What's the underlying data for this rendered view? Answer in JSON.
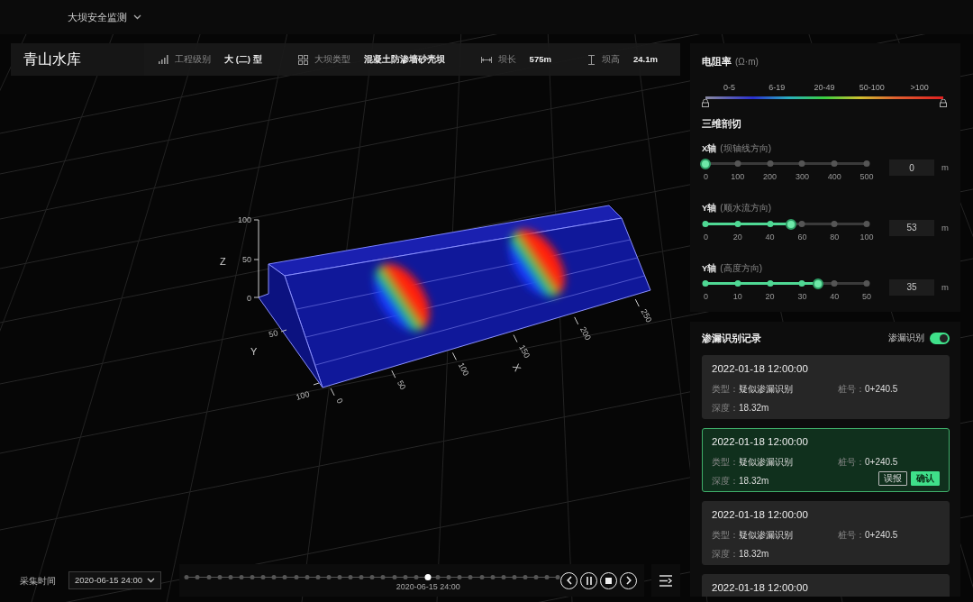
{
  "header": {
    "title": "大坝安全监测"
  },
  "info": {
    "name": "青山水库",
    "stats": [
      {
        "kind": "level",
        "label": "工程级别",
        "value": "大 (二) 型"
      },
      {
        "kind": "type",
        "label": "大坝类型",
        "value": "混凝土防渗墙砂壳坝"
      },
      {
        "kind": "length",
        "label": "坝长",
        "value": "575m"
      },
      {
        "kind": "height",
        "label": "坝高",
        "value": "24.1m"
      }
    ]
  },
  "model": {
    "z_label": "Z",
    "z_ticks": [
      "100",
      "50",
      "0"
    ],
    "y_label": "Y",
    "y_ticks": [
      "50",
      "100"
    ],
    "x_label": "X",
    "x_ticks": [
      "0",
      "50",
      "100",
      "150",
      "200",
      "250"
    ]
  },
  "resistivity": {
    "title": "电阻率",
    "unit": "(Ω·m)",
    "ranges": [
      "0-5",
      "6-19",
      "20-49",
      "50-100",
      ">100"
    ]
  },
  "cutting": {
    "title": "三维剖切",
    "axes": [
      {
        "name": "X轴",
        "hint": "(坝轴线方向)",
        "ticks": [
          "0",
          "100",
          "200",
          "300",
          "400",
          "500"
        ],
        "level": 0,
        "value": "0",
        "unit": "m"
      },
      {
        "name": "Y轴",
        "hint": "(顺水流方向)",
        "ticks": [
          "0",
          "20",
          "40",
          "60",
          "80",
          "100"
        ],
        "level": 0.53,
        "value": "53",
        "unit": "m"
      },
      {
        "name": "Y轴",
        "hint": "(高度方向)",
        "ticks": [
          "0",
          "10",
          "20",
          "30",
          "40",
          "50"
        ],
        "level": 0.7,
        "value": "35",
        "unit": "m"
      }
    ]
  },
  "records": {
    "title": "渗漏识别记录",
    "toggle": {
      "label": "渗漏识别",
      "on": true
    },
    "items": [
      {
        "time": "2022-01-18 12:00:00",
        "selected": false,
        "fields": [
          {
            "label": "类型：",
            "value": "疑似渗漏识别"
          },
          {
            "label": "桩号：",
            "value": "0+240.5"
          },
          {
            "label": "深度：",
            "value": "18.32m"
          }
        ]
      },
      {
        "time": "2022-01-18 12:00:00",
        "selected": true,
        "fields": [
          {
            "label": "类型：",
            "value": "疑似渗漏识别"
          },
          {
            "label": "桩号：",
            "value": "0+240.5"
          },
          {
            "label": "深度：",
            "value": "18.32m"
          }
        ],
        "actions": [
          {
            "kind": "outline",
            "label": "误报"
          },
          {
            "kind": "primary",
            "label": "确认"
          }
        ]
      },
      {
        "time": "2022-01-18 12:00:00",
        "selected": false,
        "fields": [
          {
            "label": "类型：",
            "value": "疑似渗漏识别"
          },
          {
            "label": "桩号：",
            "value": "0+240.5"
          },
          {
            "label": "深度：",
            "value": "18.32m"
          }
        ]
      },
      {
        "time": "2022-01-18 12:00:00",
        "selected": false
      }
    ]
  },
  "timeline": {
    "label": "采集时间",
    "date": "2020-06-15 24:00",
    "current": "2020-06-15 24:00",
    "level": 0.65
  }
}
